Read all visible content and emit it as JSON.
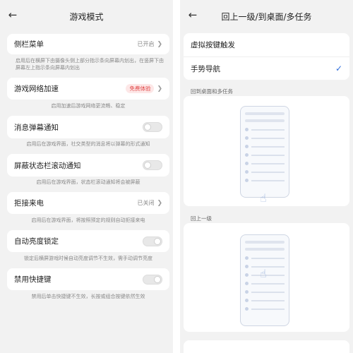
{
  "left": {
    "title": "游戏模式",
    "items": [
      {
        "label": "侧栏菜单",
        "value": "已开启",
        "desc": "启用后在横屏下由摄像头侧上部分指示条向屏幕内划出，在竖屏下由屏幕左上指示条向屏幕内划出"
      },
      {
        "label": "游戏网络加速",
        "badge": "免费体验",
        "desc": "启用加速后游戏网络更流畅、稳定"
      },
      {
        "label": "消息弹幕通知",
        "toggle": "off",
        "desc": "启用后在游戏界面，社交类型的消息将以弹幕的形式通知"
      },
      {
        "label": "屏蔽状态栏滚动通知",
        "toggle": "off",
        "desc": "启用后在游戏界面，状态栏滚动通知将会被屏蔽"
      },
      {
        "label": "拒接来电",
        "value": "已关闭",
        "desc": "启用后在游戏界面，将按照预定的规则自动拒接来电"
      },
      {
        "label": "自动亮度锁定",
        "toggle": "on",
        "desc": "锁定后横屏游戏时候自动亮度调节不生效，需手动调节亮度"
      },
      {
        "label": "禁用快捷键",
        "toggle": "on",
        "desc": "禁用后单击快捷键不生效，长按或组合按键依然生效"
      }
    ]
  },
  "right": {
    "title": "回上一级/到桌面/多任务",
    "options": [
      {
        "label": "虚拟按键触发",
        "selected": false
      },
      {
        "label": "手势导航",
        "selected": true
      }
    ],
    "section1": "回到桌面和多任务",
    "section2": "回上一级"
  },
  "icons": {
    "back": "arrow-left-icon",
    "chevron": "chevron-right-icon",
    "check": "check-icon",
    "hand": "hand-gesture-icon"
  },
  "colors": {
    "accent": "#2f6fdc",
    "badge_text": "#e04444",
    "background": "#f2f2f2"
  }
}
